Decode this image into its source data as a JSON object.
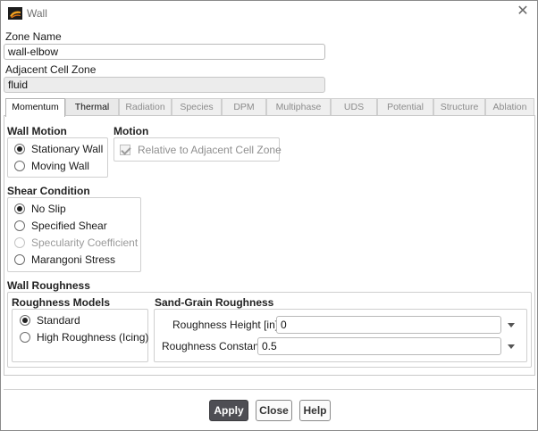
{
  "window": {
    "title": "Wall",
    "icon": "fluent-app-icon"
  },
  "zone": {
    "name_label": "Zone Name",
    "name_value": "wall-elbow",
    "adjacent_label": "Adjacent Cell Zone",
    "adjacent_value": "fluid"
  },
  "tabs": [
    {
      "label": "Momentum",
      "state": "active"
    },
    {
      "label": "Thermal",
      "state": "enabled"
    },
    {
      "label": "Radiation",
      "state": "disabled"
    },
    {
      "label": "Species",
      "state": "disabled"
    },
    {
      "label": "DPM",
      "state": "disabled"
    },
    {
      "label": "Multiphase",
      "state": "disabled"
    },
    {
      "label": "UDS",
      "state": "disabled"
    },
    {
      "label": "Potential",
      "state": "disabled"
    },
    {
      "label": "Structure",
      "state": "disabled"
    },
    {
      "label": "Ablation",
      "state": "disabled"
    }
  ],
  "wall_motion": {
    "title": "Wall Motion",
    "options": [
      {
        "label": "Stationary Wall",
        "checked": true
      },
      {
        "label": "Moving Wall",
        "checked": false
      }
    ]
  },
  "motion": {
    "title": "Motion",
    "checkbox_label": "Relative to Adjacent Cell Zone",
    "checked": true
  },
  "shear_condition": {
    "title": "Shear Condition",
    "options": [
      {
        "label": "No Slip",
        "checked": true,
        "disabled": false
      },
      {
        "label": "Specified Shear",
        "checked": false,
        "disabled": false
      },
      {
        "label": "Specularity Coefficient",
        "checked": false,
        "disabled": true
      },
      {
        "label": "Marangoni Stress",
        "checked": false,
        "disabled": false
      }
    ]
  },
  "wall_roughness": {
    "title": "Wall Roughness",
    "models_title": "Roughness Models",
    "models": [
      {
        "label": "Standard",
        "checked": true
      },
      {
        "label": "High Roughness (Icing)",
        "checked": false
      }
    ],
    "sand_grain_title": "Sand-Grain Roughness",
    "height_label": "Roughness Height [in]",
    "height_value": "0",
    "constant_label": "Roughness Constant",
    "constant_value": "0.5"
  },
  "buttons": {
    "apply": "Apply",
    "close": "Close",
    "help": "Help"
  }
}
